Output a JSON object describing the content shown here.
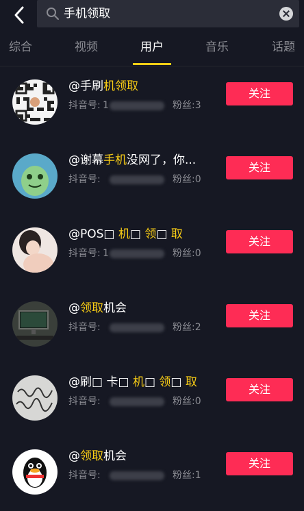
{
  "search": {
    "query": "手机领取"
  },
  "tabs": [
    {
      "label": "综合"
    },
    {
      "label": "视频"
    },
    {
      "label": "用户"
    },
    {
      "label": "音乐"
    },
    {
      "label": "话题"
    }
  ],
  "active_tab": "用户",
  "colors": {
    "background": "#161823",
    "accent": "#face15",
    "follow_button": "#fe2c55"
  },
  "users": [
    {
      "name_parts": [
        {
          "text": "@",
          "hl": false
        },
        {
          "text": "手刷",
          "hl": false
        },
        {
          "text": "机领取",
          "hl": true
        }
      ],
      "id_label": "抖音号:",
      "id_visible": "1",
      "fans": "粉丝:3",
      "follow": "关注",
      "avatar": "qr-code-avatar"
    },
    {
      "name_parts": [
        {
          "text": "@谢幕",
          "hl": false
        },
        {
          "text": "手机",
          "hl": true
        },
        {
          "text": "没网了，你...",
          "hl": false
        }
      ],
      "id_label": "抖音号:",
      "id_visible": "",
      "fans": "粉丝:0",
      "follow": "关注",
      "avatar": "green-cartoon-avatar"
    },
    {
      "name_parts": [
        {
          "text": "@POS□ ",
          "hl": false
        },
        {
          "text": "机",
          "hl": true
        },
        {
          "text": "□ ",
          "hl": false
        },
        {
          "text": "领",
          "hl": true
        },
        {
          "text": "□ ",
          "hl": false
        },
        {
          "text": "取",
          "hl": true
        }
      ],
      "id_label": "抖音号:",
      "id_visible": "1",
      "fans": "粉丝:0",
      "follow": "关注",
      "avatar": "photo-girl-avatar"
    },
    {
      "name_parts": [
        {
          "text": "@",
          "hl": false
        },
        {
          "text": "领取",
          "hl": true
        },
        {
          "text": "机会",
          "hl": false
        }
      ],
      "id_label": "抖音号:",
      "id_visible": "",
      "fans": "粉丝:2",
      "follow": "关注",
      "avatar": "monitor-desk-avatar"
    },
    {
      "name_parts": [
        {
          "text": "@刷□ 卡□ ",
          "hl": false
        },
        {
          "text": "机",
          "hl": true
        },
        {
          "text": "□ ",
          "hl": false
        },
        {
          "text": "领",
          "hl": true
        },
        {
          "text": "□ ",
          "hl": false
        },
        {
          "text": "取",
          "hl": true
        }
      ],
      "id_label": "抖音号:",
      "id_visible": "",
      "fans": "粉丝:0",
      "follow": "关注",
      "avatar": "handwriting-avatar"
    },
    {
      "name_parts": [
        {
          "text": "@",
          "hl": false
        },
        {
          "text": "领取",
          "hl": true
        },
        {
          "text": "机会",
          "hl": false
        }
      ],
      "id_label": "抖音号:",
      "id_visible": "",
      "fans": "粉丝:1",
      "follow": "关注",
      "avatar": "penguin-avatar"
    }
  ]
}
